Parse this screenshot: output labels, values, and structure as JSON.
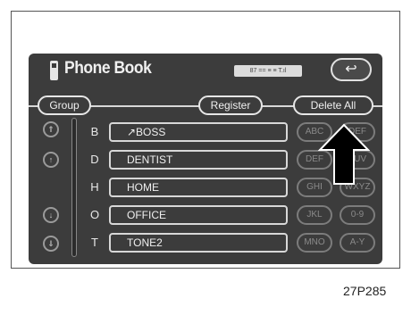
{
  "header": {
    "title": "Phone Book",
    "status_text": "87  ==  ≡ ≡  T.ıl",
    "back_symbol": "↩"
  },
  "tabs": {
    "group": "Group",
    "register": "Register",
    "delete_all": "Delete All"
  },
  "scroll_buttons": [
    "⇑",
    "↑",
    "↓",
    "⇓"
  ],
  "rows": [
    {
      "letter": "B",
      "name": "↗BOSS",
      "alpha1": "ABC",
      "alpha2": "DEF"
    },
    {
      "letter": "D",
      "name": "DENTIST",
      "alpha1": "DEF",
      "alpha2": "TUV"
    },
    {
      "letter": "H",
      "name": "HOME",
      "alpha1": "GHI",
      "alpha2": "WXYZ"
    },
    {
      "letter": "O",
      "name": "OFFICE",
      "alpha1": "JKL",
      "alpha2": "0-9"
    },
    {
      "letter": "T",
      "name": "TONE2",
      "alpha1": "MNO",
      "alpha2": "A-Y"
    }
  ],
  "caption": "27P285",
  "colors": {
    "screen": "#3c3c3c",
    "text": "#f0f0f0",
    "arrow": "#000000"
  },
  "icons": {
    "phone": "phone-book-icon",
    "back": "return-icon",
    "pointer": "up-arrow-icon"
  }
}
